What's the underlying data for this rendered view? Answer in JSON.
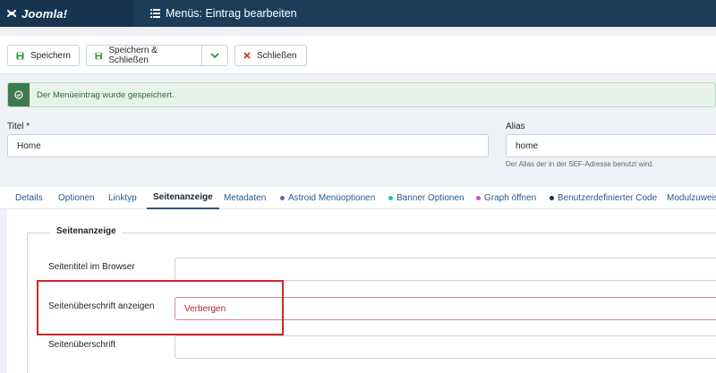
{
  "header": {
    "logo_text": "Joomla!",
    "page_title": "Menüs: Eintrag bearbeiten",
    "colors": {
      "bar": "#1c3d5a",
      "logo_bg": "#163550"
    }
  },
  "toolbar": {
    "save_label": "Speichern",
    "save_close_label": "Speichern & Schließen",
    "close_label": "Schließen"
  },
  "alert": {
    "message": "Der Menüeintrag wurde gespeichert."
  },
  "form": {
    "title_label": "Titel *",
    "title_value": "Home",
    "alias_label": "Alias",
    "alias_value": "home",
    "alias_help": "Der Alias der in der SEF-Adresse benutzt wird."
  },
  "tabs": [
    {
      "label": "Details"
    },
    {
      "label": "Optionen"
    },
    {
      "label": "Linktyp"
    },
    {
      "label": "Seitenanzeige",
      "active": true
    },
    {
      "label": "Metadaten"
    },
    {
      "label": "Astroid Menüoptionen",
      "dot_color": "#5b6bb5"
    },
    {
      "label": "Banner Optionen",
      "dot_color": "#2fb8c4"
    },
    {
      "label": "Graph öffnen",
      "dot_color": "#d04fc4"
    },
    {
      "label": "Benutzerdefinierter Code",
      "dot_color": "#1a2560"
    },
    {
      "label": "Modulzuweis"
    }
  ],
  "page_display": {
    "legend": "Seitenanzeige",
    "browser_title_label": "Seitentitel im Browser",
    "browser_title_value": "",
    "show_heading_label": "Seitenüberschrift anzeigen",
    "show_heading_value": "Verbergen",
    "heading_label": "Seitenüberschrift",
    "heading_value": ""
  }
}
